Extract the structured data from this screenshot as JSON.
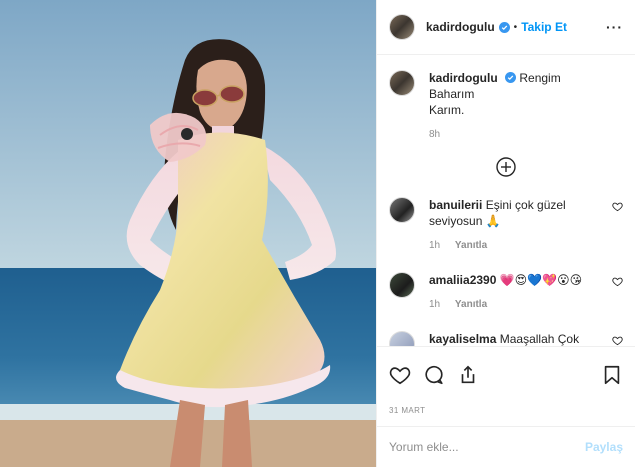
{
  "post": {
    "username": "kadirdogulu",
    "follow_label": "Takip Et",
    "dot": "•",
    "more": "···"
  },
  "caption": {
    "username": "kadirdogulu",
    "lines": [
      "Rengim",
      "Baharım",
      "Karım."
    ],
    "time": "8h"
  },
  "comments": [
    {
      "username": "banuilerii",
      "text": "Eşini çok güzel seviyosun 🙏",
      "time": "1h",
      "reply": "Yanıtla"
    },
    {
      "username": "amaliia2390",
      "text": "💗😍💙💖😮😘",
      "time": "1h",
      "reply": "Yanıtla"
    },
    {
      "username": "kayaliselma",
      "text": "Maaşallah Çok Güzel",
      "time": "",
      "reply": ""
    }
  ],
  "date": "31 MART",
  "add_comment": {
    "placeholder": "Yorum ekle...",
    "post_label": "Paylaş"
  },
  "colors": {
    "accent": "#0095f6",
    "verified": "#3897f0",
    "post_disabled": "#b2dffc"
  },
  "icons": [
    "verified-badge-icon",
    "heart-icon",
    "comment-icon",
    "share-icon",
    "bookmark-icon",
    "plus-circle-icon"
  ]
}
